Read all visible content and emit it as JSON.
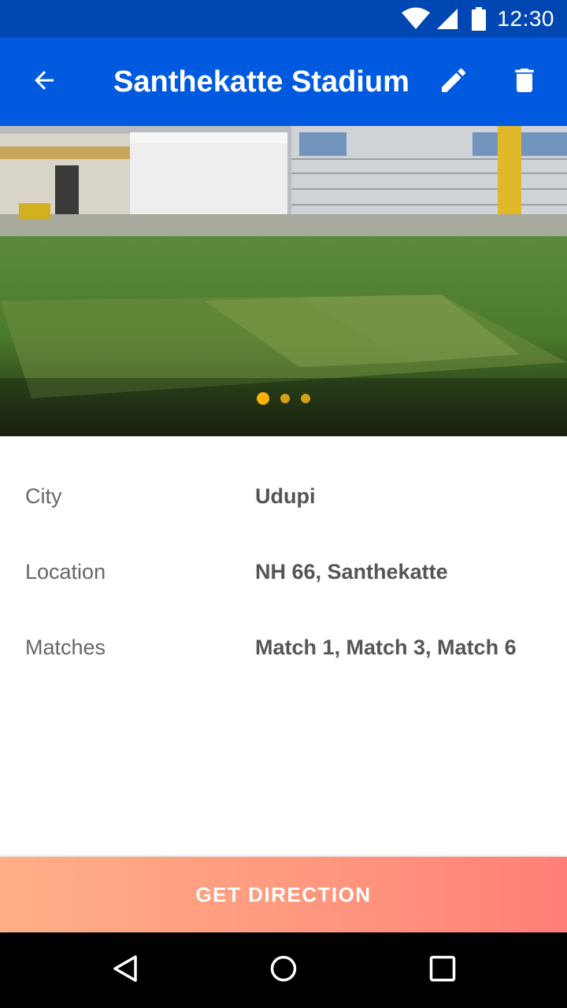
{
  "status_bar": {
    "time": "12:30",
    "icons": [
      "wifi-icon",
      "cellular-signal-icon",
      "battery-icon"
    ]
  },
  "app_bar": {
    "title": "Santhekatte Stadium",
    "back_icon": "arrow-back-icon",
    "edit_icon": "pencil-icon",
    "delete_icon": "trash-icon",
    "color": "#005ae0"
  },
  "hero": {
    "image_description_icon": "stadium-photo",
    "carousel": {
      "count": 3,
      "active_index": 0,
      "active_color": "#ffb300"
    }
  },
  "details": {
    "rows": [
      {
        "label": "City",
        "value": "Udupi"
      },
      {
        "label": "Location",
        "value": "NH 66, Santhekatte"
      },
      {
        "label": "Matches",
        "value": "Match 1, Match 3, Match 6"
      }
    ]
  },
  "cta": {
    "label": "GET DIRECTION",
    "gradient": [
      "#ffae88",
      "#ff7f78"
    ]
  },
  "nav_bar": {
    "icons": [
      "back-triangle-icon",
      "home-circle-icon",
      "recents-square-icon"
    ]
  }
}
